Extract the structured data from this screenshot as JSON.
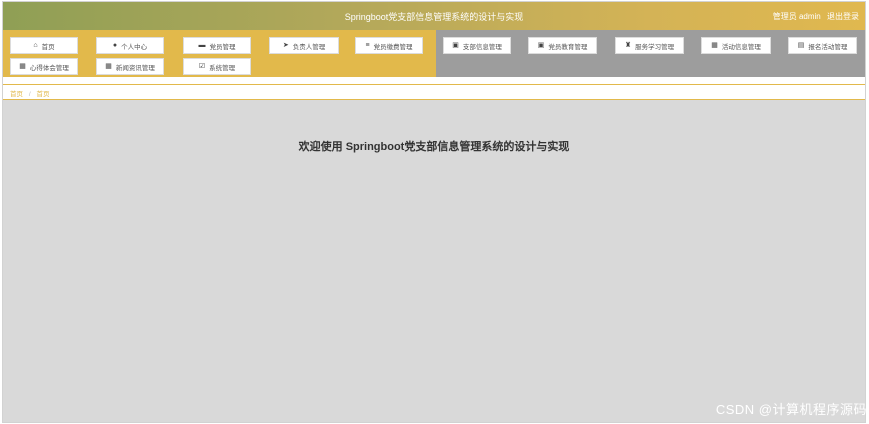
{
  "header": {
    "title": "Springboot党支部信息管理系统的设计与实现",
    "user_label": "管理员 admin",
    "logout_label": "退出登录"
  },
  "menu": [
    {
      "label": "首页",
      "icon": "home-icon"
    },
    {
      "label": "个人中心",
      "icon": "user-icon"
    },
    {
      "label": "党员管理",
      "icon": "briefcase-icon"
    },
    {
      "label": "负责人管理",
      "icon": "send-icon"
    },
    {
      "label": "党员缴费管理",
      "icon": "sliders-icon"
    },
    {
      "label": "支部信息管理",
      "icon": "clipboard-icon"
    },
    {
      "label": "党员教育管理",
      "icon": "clipboard-icon"
    },
    {
      "label": "服务学习管理",
      "icon": "trophy-icon"
    },
    {
      "label": "活动信息管理",
      "icon": "grid-icon"
    },
    {
      "label": "报名活动管理",
      "icon": "book-icon"
    },
    {
      "label": "心得体会管理",
      "icon": "grid-icon"
    },
    {
      "label": "新闻资讯管理",
      "icon": "grid-icon"
    },
    {
      "label": "系统管理",
      "icon": "checkbox-icon"
    }
  ],
  "breadcrumb": {
    "root": "首页",
    "separator": "/",
    "current": "首页"
  },
  "main": {
    "welcome": "欢迎使用 Springboot党支部信息管理系统的设计与实现"
  },
  "watermark": "CSDN @计算机程序源码",
  "colors": {
    "accent": "#e2b94b",
    "header_start": "#8f9f55",
    "header_end": "#e0b84f",
    "menu_gray": "#9d9d9d",
    "content_bg": "#d9d9d9"
  }
}
